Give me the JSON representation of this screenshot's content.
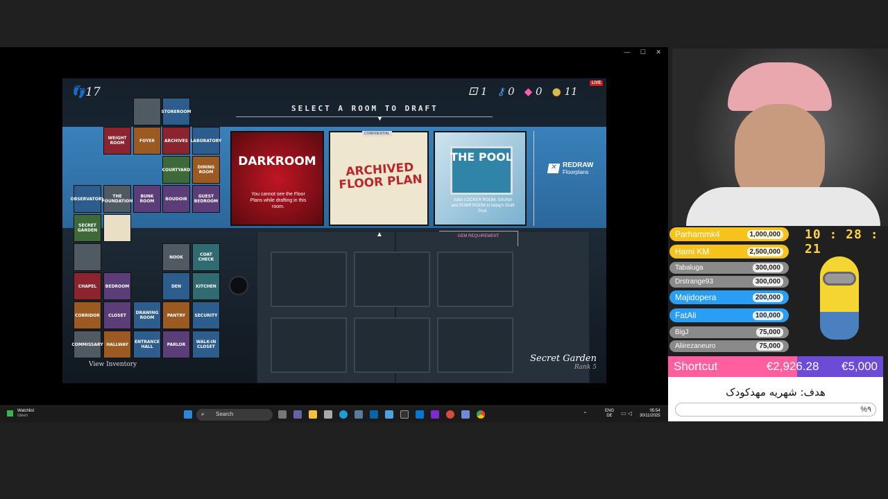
{
  "window": {
    "controls": "— ☐ ✕"
  },
  "game": {
    "steps": "17",
    "resources": {
      "dice": "1",
      "keys": "0",
      "gems": "0",
      "coins": "11"
    },
    "live_badge": "LIVE",
    "draft_title": "SELECT A ROOM TO DRAFT",
    "cards": [
      {
        "title": "DARKROOM",
        "text": "You cannot see the Floor Plans while drafting in this room."
      },
      {
        "title": "ARCHIVED FLOOR PLAN",
        "stamp": "CONFIDENTIAL"
      },
      {
        "title": "THE POOL",
        "text": "Adds LOCKER ROOM, SAUNA and PUMP ROOM to today's Draft Pool."
      }
    ],
    "redraw": {
      "label": "REDRAW",
      "sub": "Floorplans"
    },
    "gem_requirement": "GEM REQUIREMENT",
    "view_inventory": "View Inventory",
    "location": {
      "name": "Secret Garden",
      "rank": "Rank 5"
    },
    "map_rooms": [
      "STOREROOM",
      "WEIGHT ROOM",
      "FOYER",
      "ARCHIVES",
      "LABORATORY",
      "COURTYARD",
      "DINING ROOM",
      "OBSERVATORY",
      "THE FOUNDATION",
      "BUNK ROOM",
      "BOUDOIR",
      "GUEST BEDROOM",
      "SECRET GARDEN",
      "NOOK",
      "COAT CHECK",
      "CHAPEL",
      "BEDROOM",
      "DEN",
      "KITCHEN",
      "CORRIDOR",
      "CLOSET",
      "DRAWING ROOM",
      "PANTRY",
      "SECURITY",
      "COMMISSARY",
      "HALLWAY",
      "ENTRANCE HALL",
      "PARLOR",
      "WALK-IN CLOSET"
    ]
  },
  "taskbar": {
    "watchlist": "Watchlist",
    "watchlist_sub": "Ideen",
    "search_placeholder": "Search",
    "lang": "ENG",
    "lang_sub": "DE",
    "time": "05:54",
    "date": "30/11/2025"
  },
  "stream": {
    "clock": "10 : 28 : 21",
    "donors": [
      {
        "name": "Parhammk4",
        "amount": "1,000,000",
        "color": "#f6c31c"
      },
      {
        "name": "Hami KM",
        "amount": "2,500,000",
        "color": "#f6c31c"
      },
      {
        "name": "Tabaluga",
        "amount": "300,000",
        "color": "#8a8a8a"
      },
      {
        "name": "Drstrange93",
        "amount": "300,000",
        "color": "#8a8a8a"
      },
      {
        "name": "Majidopera",
        "amount": "200,000",
        "color": "#2a9df4"
      },
      {
        "name": "FatAli",
        "amount": "100,000",
        "color": "#2a9df4"
      },
      {
        "name": "BigJ",
        "amount": "75,000",
        "color": "#8a8a8a"
      },
      {
        "name": "Aliirezaneuro",
        "amount": "75,000",
        "color": "#8a8a8a"
      }
    ],
    "shortcut": {
      "label": "Shortcut",
      "current": "€2,926.28",
      "target": "€5,000"
    },
    "goal": {
      "title": "هدف: شهریه مهدکودک",
      "percent": "%٩"
    }
  }
}
